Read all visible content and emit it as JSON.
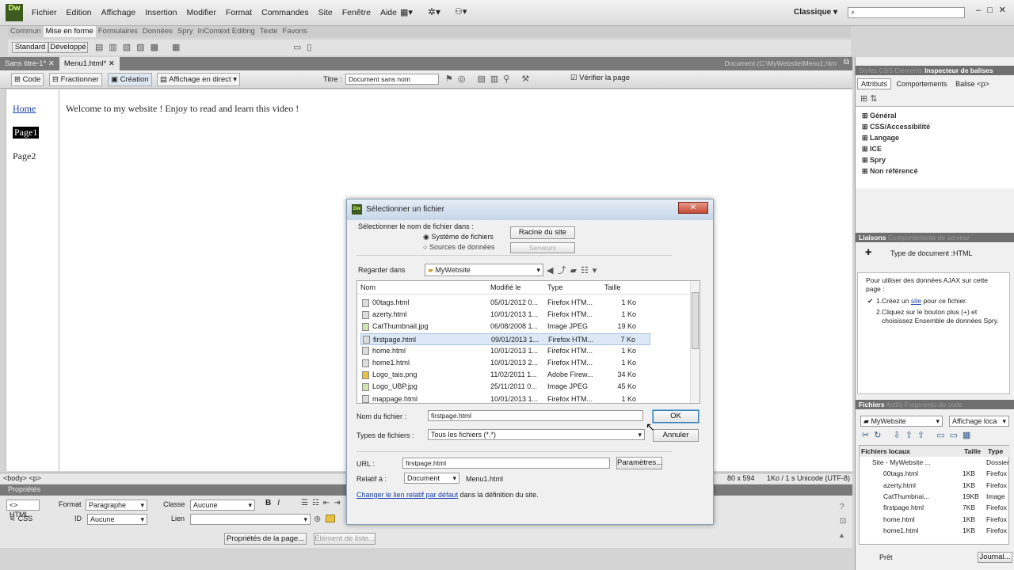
{
  "menubar": {
    "items": [
      "Fichier",
      "Edition",
      "Affichage",
      "Insertion",
      "Modifier",
      "Format",
      "Commandes",
      "Site",
      "Fenêtre",
      "Aide"
    ],
    "workspace": "Classique"
  },
  "insert_bar": {
    "tabs": [
      "Commun",
      "Mise en forme",
      "Formulaires",
      "Données",
      "Spry",
      "InContext Editing",
      "Texte",
      "Favoris"
    ],
    "active_tab": "Mise en forme",
    "mode_buttons": [
      "Standard",
      "Développé"
    ]
  },
  "doc_tabs": [
    "Sans titre-1*",
    "Menu1.html*"
  ],
  "doc_path": "Document (C:\\MyWebsite\\Menu1.htm",
  "doc_toolbar": {
    "code": "Code",
    "split": "Fractionner",
    "design": "Création",
    "live": "Affichage en direct",
    "title_label": "Titre :",
    "title_value": "Document sans nom",
    "validate": "Vérifier la page"
  },
  "page": {
    "nav": [
      "Home",
      "Page1",
      "Page2"
    ],
    "content": "Welcome to my website ! Enjoy to read and learn this video !"
  },
  "status": {
    "tags": "<body> <p>",
    "size": "80 x 594",
    "weight": "1Ko / 1 s",
    "encoding": "Unicode (UTF-8)"
  },
  "properties": {
    "header": "Propriétés",
    "html": "HTML",
    "css": "CSS",
    "format_label": "Format",
    "format_value": "Paragraphe",
    "classe_label": "Classe",
    "classe_value": "Aucune",
    "id_label": "ID",
    "id_value": "Aucune",
    "lien_label": "Lien",
    "page_props": "Propriétés de la page...",
    "list_item": "Élément de liste..."
  },
  "right_panel": {
    "tab_css": "Styles CSS",
    "tab_elements": "Éléments",
    "tab_tag": "Inspecteur de balises",
    "attr_tabs": [
      "Attributs",
      "Comportements",
      "Balise <p>"
    ],
    "categories": [
      "Général",
      "CSS/Accessibilité",
      "Langage",
      "ICE",
      "Spry",
      "Non référencé"
    ],
    "liaisons_tab": "Liaisons",
    "behaviors_tab": "Comportements de serveur",
    "doc_type": "Type de document :HTML",
    "ajax_intro": "Pour utiliser des données AJAX sur cette page :",
    "step1_pre": "Créez un",
    "step1_link": "site",
    "step1_post": "pour ce fichier.",
    "step2": "Cliquez sur le bouton plus (+) et choisissez Ensemble de données Spry.",
    "files_tab": "Fichiers",
    "assets_tab": "Actifs",
    "snippets_tab": "Fragments de code",
    "site_select": "MyWebsite",
    "view_select": "Affichage loca",
    "col_local": "Fichiers locaux",
    "col_size": "Taille",
    "col_type": "Type",
    "files": [
      {
        "name": "Site - MyWebsite ...",
        "size": "",
        "type": "Dossier"
      },
      {
        "name": "00tags.html",
        "size": "1KB",
        "type": "Firefox"
      },
      {
        "name": "azerty.html",
        "size": "1KB",
        "type": "Firefox"
      },
      {
        "name": "CatThumbnai...",
        "size": "19KB",
        "type": "Image"
      },
      {
        "name": "firstpage.html",
        "size": "7KB",
        "type": "Firefox"
      },
      {
        "name": "home.html",
        "size": "1KB",
        "type": "Firefox"
      },
      {
        "name": "home1.html",
        "size": "1KB",
        "type": "Firefox"
      }
    ],
    "ready": "Prêt",
    "journal": "Journal..."
  },
  "dialog": {
    "title": "Sélectionner un fichier",
    "select_from": "Sélectionner le nom de fichier dans :",
    "radio_fs": "Système de fichiers",
    "radio_ds": "Sources de données",
    "site_root": "Racine du site",
    "servers": "Serveurs",
    "look_in_label": "Regarder dans",
    "look_in_value": "MyWebsite",
    "columns": [
      "Nom",
      "Modifié le",
      "Type",
      "Taille"
    ],
    "files": [
      {
        "name": "00tags.html",
        "modified": "05/01/2012 0...",
        "type": "Firefox HTM...",
        "size": "1 Ko",
        "kind": "html"
      },
      {
        "name": "azerty.html",
        "modified": "10/01/2013 1...",
        "type": "Firefox HTM...",
        "size": "1 Ko",
        "kind": "html"
      },
      {
        "name": "CatThumbnail.jpg",
        "modified": "06/08/2008 1...",
        "type": "Image JPEG",
        "size": "19 Ko",
        "kind": "jpg"
      },
      {
        "name": "firstpage.html",
        "modified": "09/01/2013 1...",
        "type": "Firefox HTM...",
        "size": "7 Ko",
        "kind": "html"
      },
      {
        "name": "home.html",
        "modified": "10/01/2013 1...",
        "type": "Firefox HTM...",
        "size": "1 Ko",
        "kind": "html"
      },
      {
        "name": "home1.html",
        "modified": "10/01/2013 2...",
        "type": "Firefox HTM...",
        "size": "1 Ko",
        "kind": "html"
      },
      {
        "name": "Logo_tais.png",
        "modified": "11/02/2011 1...",
        "type": "Adobe Firew...",
        "size": "34 Ko",
        "kind": "png"
      },
      {
        "name": "Logo_UBP.jpg",
        "modified": "25/11/2011 0...",
        "type": "Image JPEG",
        "size": "45 Ko",
        "kind": "jpg"
      },
      {
        "name": "mappage.html",
        "modified": "10/01/2013 1...",
        "type": "Firefox HTM...",
        "size": "1 Ko",
        "kind": "html"
      }
    ],
    "selected_index": 3,
    "filename_label": "Nom du fichier :",
    "filename_value": "firstpage.html",
    "filetype_label": "Types de fichiers :",
    "filetype_value": "Tous les fichiers (*.*)",
    "ok": "OK",
    "cancel": "Annuler",
    "url_label": "URL :",
    "url_value": "firstpage.html",
    "params": "Paramètres...",
    "relative_label": "Relatif à :",
    "relative_value": "Document",
    "relative_file": "Menu1.html",
    "change_link": "Changer le lien relatif par défaut",
    "change_suffix": "dans la définition du site."
  },
  "colors": {
    "accent_blue": "#1a3fb0",
    "selection": "#dce8f5",
    "dark_panel": "#7a7a7a"
  }
}
